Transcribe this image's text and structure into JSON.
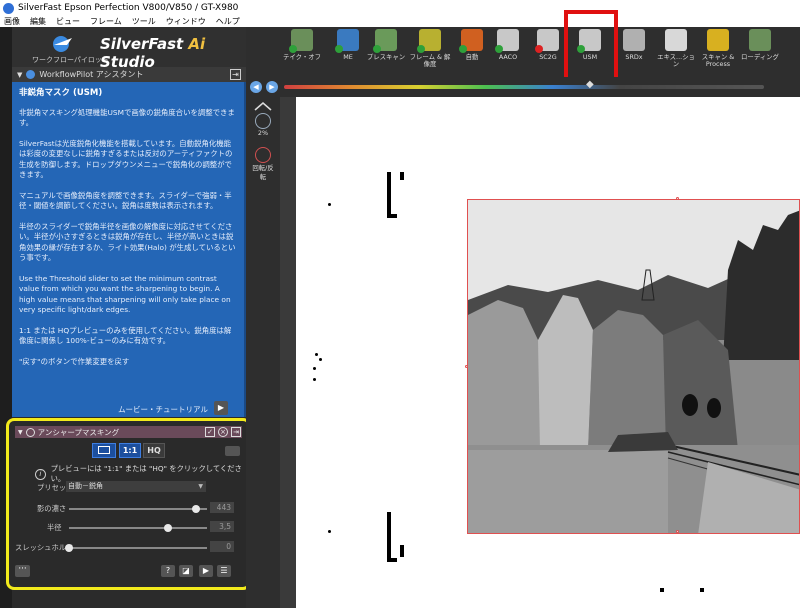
{
  "window": {
    "title": "SilverFast  Epson Perfection V800/V850 / GT-X980"
  },
  "menu": [
    "画像",
    "編集",
    "ビュー",
    "フレーム",
    "ツール",
    "ウィンドウ",
    "ヘルプ"
  ],
  "logo": {
    "subtitle": "ワークフローパイロット",
    "name": "SilverFast",
    "name_ai": "Ai",
    "name_studio": "Studio"
  },
  "workflowpilot": {
    "label": "WorkflowPilot アシスタント"
  },
  "help": {
    "title": "非鋭角マスク (USM)",
    "paragraphs": [
      "非鋭角マスキング処理機能USMで画像の鋭角度合いを調整できます。",
      "SilverFastは光度鋭角化機能を搭載しています。自動鋭角化機能は彩度の変更なしに鋭角すぎるまたは反対のアーティファクトの生成を防御します。ドロップダウンメニューで鋭角化の調整ができます。",
      "マニュアルで画像鋭角度を調整できます。スライダーで強弱・半径・閾値を調節してください。鋭角は度数は表示されます。",
      "半径のスライダーで鋭角半径を画像の解像度に対応させてください。半径が小さすぎるときは鋭角が存在し、半径が高いときは鋭角効果の縁が存在するか、ライト効果(Halo) が生成しているという事です。",
      "Use the Threshold slider to set the minimum contrast value from which you want the sharpening to begin. A high value means that sharpening will only take place on very specific light/dark edges.",
      "1:1 または HQプレビューのみを使用してください。鋭角度は解像度に関係し 100%-ビューのみに有効です。",
      "\"戻す\"のボタンで作業変更を戻す"
    ],
    "footer_link": "ムービー・チュートリアル"
  },
  "usm_panel": {
    "title": "アンシャープマスキング",
    "preview_buttons": {
      "one_to_one": "1:1",
      "hq": "HQ"
    },
    "info": "プレビューには \"1:1\" または \"HQ\" をクリックしてください。",
    "preset_label": "プリセット",
    "preset_value": "自動－鋭角",
    "sliders": [
      {
        "label": "影の濃さ",
        "value": "443",
        "level": 0.92
      },
      {
        "label": "半径",
        "value": "3,5",
        "level": 0.72
      },
      {
        "label": "スレッシュホルド",
        "value": "0",
        "level": 0.0
      }
    ]
  },
  "toolbar": {
    "items": [
      {
        "label": "テイク・オフ",
        "icon": "airplane-takeoff-icon",
        "color": "#6a8f5a",
        "status": "ok"
      },
      {
        "label": "ME",
        "icon": "me-globe-icon",
        "color": "#3a7ac0",
        "status": "ok"
      },
      {
        "label": "プレスキャン",
        "icon": "prescan-icon",
        "color": "#6a9a5a",
        "status": "ok"
      },
      {
        "label": "フレーム & 解像度",
        "icon": "frame-resolution-icon",
        "color": "#b8b030",
        "status": "ok"
      },
      {
        "label": "自動",
        "icon": "auto-adjust-icon",
        "color": "#d06020",
        "status": "ok"
      },
      {
        "label": "AACO",
        "icon": "aaco-icon",
        "color": "#c8c8c8",
        "status": "ok"
      },
      {
        "label": "SC2G",
        "icon": "sc2g-icon",
        "color": "#c8c8c8",
        "status": "error"
      },
      {
        "label": "USM",
        "icon": "usm-triangle-icon",
        "color": "#c8c8c8",
        "status": "ok"
      },
      {
        "label": "SRDx",
        "icon": "srdx-icon",
        "color": "#b0b0b0",
        "status": "none"
      },
      {
        "label": "エキス...ション",
        "icon": "expansion-icon",
        "color": "#d8d8d8",
        "status": "none"
      },
      {
        "label": "スキャン & Process",
        "icon": "scan-process-icon",
        "color": "#d8b020",
        "status": "none"
      },
      {
        "label": "ローディング",
        "icon": "loading-plane-icon",
        "color": "#6a8f5a",
        "status": "none"
      }
    ]
  },
  "side_tools": {
    "zoom_label": "2%",
    "rotate_label": "回転/反転"
  }
}
